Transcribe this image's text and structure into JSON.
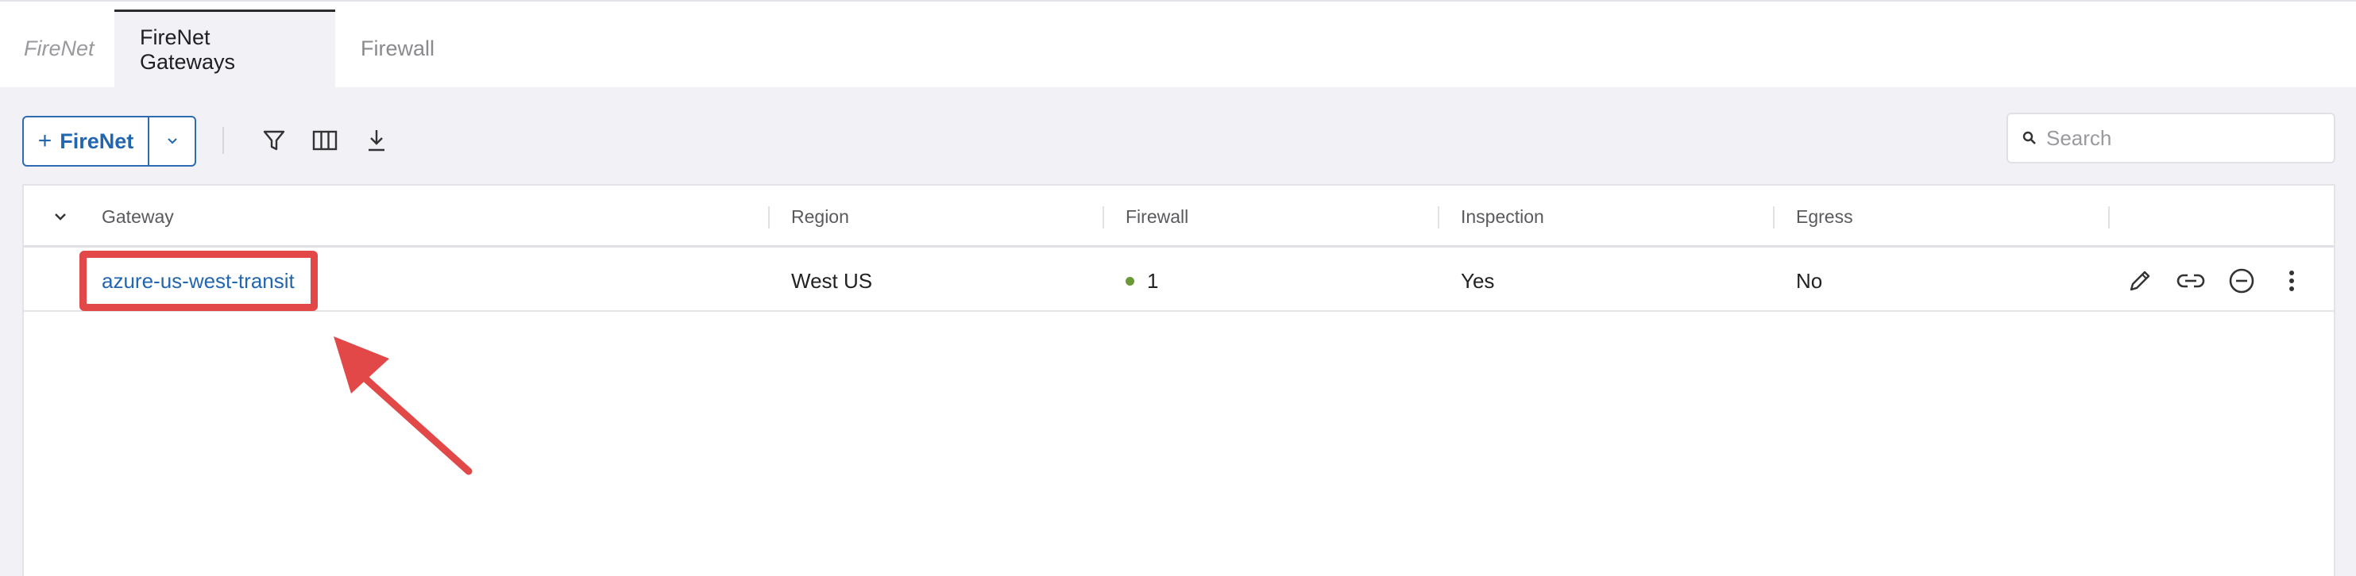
{
  "tabs": [
    {
      "label": "FireNet"
    },
    {
      "label": "FireNet Gateways"
    },
    {
      "label": "Firewall"
    }
  ],
  "toolbar": {
    "add_label": "FireNet",
    "add_icon": "plus-icon",
    "dropdown_icon": "chevron-down-icon",
    "filter_icon": "filter-icon",
    "columns_icon": "columns-icon",
    "download_icon": "download-icon"
  },
  "search": {
    "placeholder": "Search",
    "value": ""
  },
  "table": {
    "columns": [
      "Gateway",
      "Region",
      "Firewall",
      "Inspection",
      "Egress"
    ],
    "rows": [
      {
        "gateway": "azure-us-west-transit",
        "region": "West US",
        "firewall": "1",
        "inspection": "Yes",
        "egress": "No",
        "status_color": "#6a9a35",
        "actions": [
          "edit-icon",
          "link-icon",
          "remove-icon",
          "more-vertical-icon"
        ]
      }
    ]
  },
  "annotation": {
    "color": "#e24848"
  },
  "colors": {
    "accent": "#2266b0",
    "background": "#f1f1f6"
  }
}
